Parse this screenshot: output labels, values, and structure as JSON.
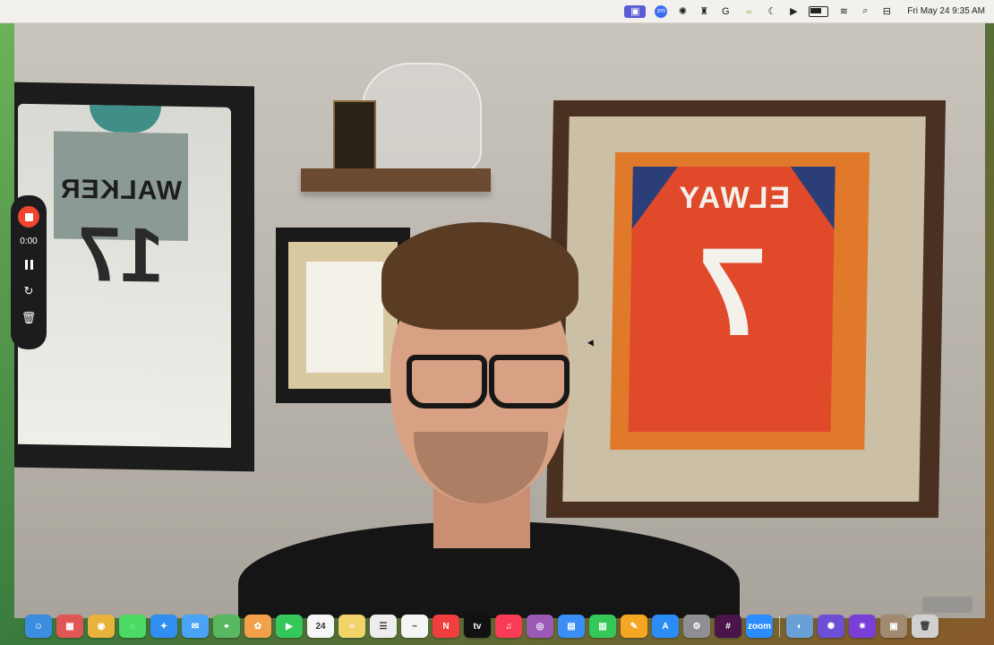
{
  "menubar": {
    "apple_glyph": "",
    "clock": "Fri May 24  9:35 AM",
    "status_icons": [
      {
        "name": "screen-record-icon",
        "glyph": "▣"
      },
      {
        "name": "zoom-icon",
        "glyph": "zm"
      },
      {
        "name": "gear-icon",
        "glyph": "✺"
      },
      {
        "name": "bookmark-icon",
        "glyph": "♜"
      },
      {
        "name": "grammarly-icon",
        "glyph": "G"
      },
      {
        "name": "loop-icon",
        "glyph": "∞"
      },
      {
        "name": "moon-icon",
        "glyph": "☾"
      },
      {
        "name": "play-circle-icon",
        "glyph": "▶"
      },
      {
        "name": "battery-icon",
        "glyph": ""
      },
      {
        "name": "wifi-icon",
        "glyph": "≋"
      },
      {
        "name": "search-icon",
        "glyph": "⌕"
      },
      {
        "name": "control-center-icon",
        "glyph": "⊟"
      }
    ]
  },
  "video": {
    "left_jersey_name": "WALKER",
    "left_jersey_number": "17",
    "right_jersey_name": "ELWAY",
    "right_jersey_number": "7"
  },
  "recorder": {
    "time": "0:00",
    "stop_label": "stop",
    "restart_glyph": "↻",
    "delete_glyph": "🗑"
  },
  "dock": {
    "calendar_day": "24",
    "items": [
      {
        "name": "finder",
        "color": "#3b8de0",
        "glyph": "☺"
      },
      {
        "name": "launchpad",
        "color": "#e25555",
        "glyph": "▦"
      },
      {
        "name": "chrome",
        "color": "#e9b23a",
        "glyph": "◉"
      },
      {
        "name": "messages",
        "color": "#4cd964",
        "glyph": "◌"
      },
      {
        "name": "safari",
        "color": "#2f8ef0",
        "glyph": "✦"
      },
      {
        "name": "mail",
        "color": "#4aa3f5",
        "glyph": "✉"
      },
      {
        "name": "maps",
        "color": "#58b860",
        "glyph": "⌖"
      },
      {
        "name": "photos",
        "color": "#f2a04a",
        "glyph": "✿"
      },
      {
        "name": "facetime",
        "color": "#34c759",
        "glyph": "▶"
      },
      {
        "name": "calendar",
        "color": "#f6f6f6",
        "glyph": "24"
      },
      {
        "name": "notes",
        "color": "#f2d36a",
        "glyph": "≡"
      },
      {
        "name": "reminders",
        "color": "#ededed",
        "glyph": "☰"
      },
      {
        "name": "freeform",
        "color": "#f5f5f5",
        "glyph": "~"
      },
      {
        "name": "news",
        "color": "#f03d3d",
        "glyph": "N"
      },
      {
        "name": "tv",
        "color": "#111111",
        "glyph": "tv"
      },
      {
        "name": "music",
        "color": "#fa3b55",
        "glyph": "♫"
      },
      {
        "name": "podcasts",
        "color": "#9b59b6",
        "glyph": "◎"
      },
      {
        "name": "keynote",
        "color": "#3a8ef5",
        "glyph": "▤"
      },
      {
        "name": "numbers",
        "color": "#34c759",
        "glyph": "▥"
      },
      {
        "name": "pages",
        "color": "#f5a623",
        "glyph": "✎"
      },
      {
        "name": "app-store",
        "color": "#2b8cf5",
        "glyph": "A"
      },
      {
        "name": "system-settings",
        "color": "#8e8e93",
        "glyph": "⚙"
      },
      {
        "name": "slack",
        "color": "#4a154b",
        "glyph": "#"
      },
      {
        "name": "zoom",
        "color": "#2d8cff",
        "glyph": "zoom"
      },
      {
        "name": "preview",
        "color": "#6aa0d8",
        "glyph": "◐"
      },
      {
        "name": "chatgpt",
        "color": "#6d4fd6",
        "glyph": "✺"
      },
      {
        "name": "perplexity",
        "color": "#7a3fd6",
        "glyph": "✷"
      },
      {
        "name": "camera-preview",
        "color": "#a08a70",
        "glyph": "▣"
      },
      {
        "name": "trash",
        "color": "#d0d0d0",
        "glyph": "🗑"
      }
    ]
  }
}
